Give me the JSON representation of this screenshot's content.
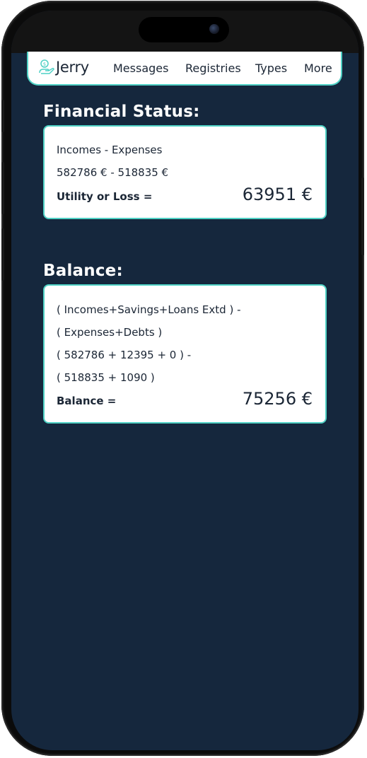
{
  "app": {
    "brand": "Jerry",
    "accent_color": "#4fd1c5",
    "background_color": "#15273d"
  },
  "nav": {
    "items": [
      "Messages",
      "Registries",
      "Types",
      "More"
    ]
  },
  "financial_status": {
    "title": "Financial Status:",
    "formula": "Incomes - Expenses",
    "values": "582786 € - 518835 €",
    "result_label": "Utility or Loss =",
    "result_value": "63951 €"
  },
  "balance": {
    "title": "Balance:",
    "formula_line1": "( Incomes+Savings+Loans Extd ) -",
    "formula_line2": "( Expenses+Debts )",
    "values_line1": "( 582786 + 12395 + 0 ) -",
    "values_line2": "( 518835 + 1090 )",
    "result_label": "Balance =",
    "result_value": "75256 €"
  }
}
